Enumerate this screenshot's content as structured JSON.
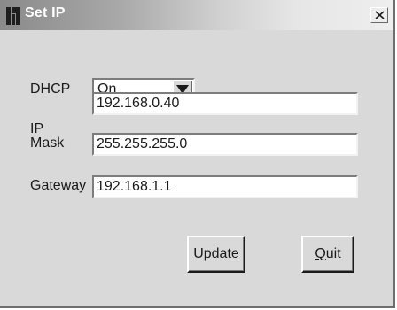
{
  "window": {
    "title": "Set IP",
    "close_glyph": "✕"
  },
  "form": {
    "dhcp": {
      "label": "DHCP",
      "value": "On",
      "options": [
        "On"
      ]
    },
    "ip": {
      "label": "IP",
      "value": "192.168.0.40"
    },
    "mask": {
      "label": "Mask",
      "value": "255.255.255.0"
    },
    "gateway": {
      "label": "Gateway",
      "value": "192.168.1.1"
    }
  },
  "buttons": {
    "update": "Update",
    "quit": {
      "mnemonic": "Q",
      "rest": "uit"
    }
  },
  "icons": {
    "logo": "kramer-logo-icon",
    "close": "close-icon",
    "dropdown": "chevron-down-icon"
  },
  "colors": {
    "window_bg": "#d9d9d9",
    "title_text": "#ffffff"
  }
}
